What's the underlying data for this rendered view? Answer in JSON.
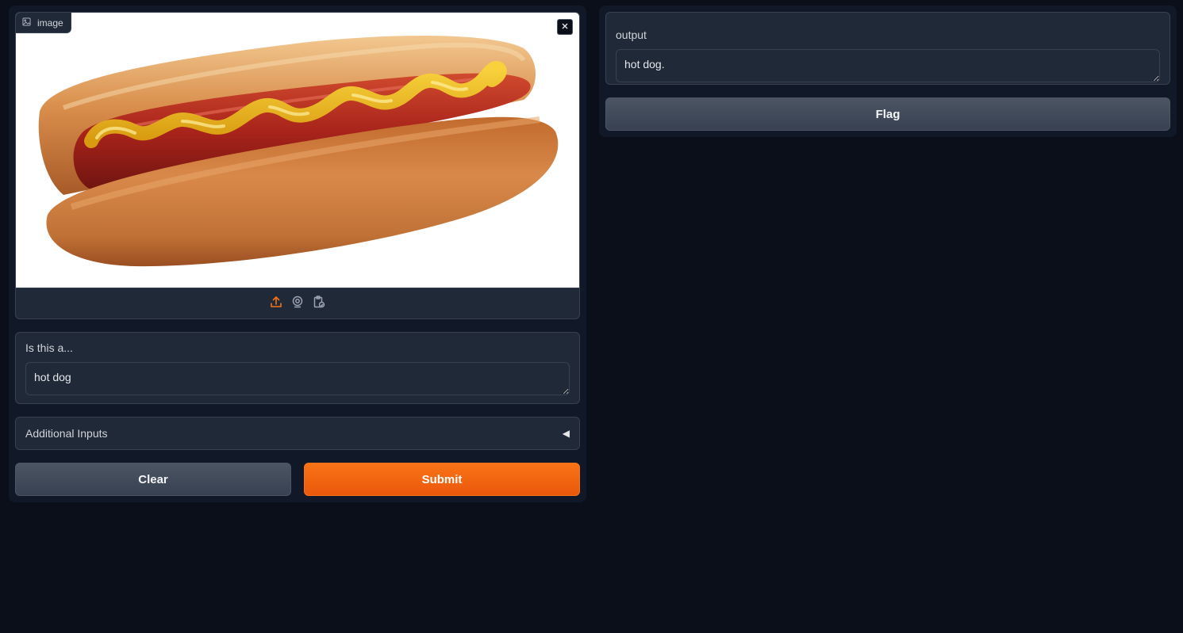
{
  "inputs": {
    "image": {
      "label": "image",
      "source_buttons": [
        {
          "name": "upload",
          "icon": "upload-icon",
          "active": true
        },
        {
          "name": "webcam",
          "icon": "webcam-icon",
          "active": false
        },
        {
          "name": "clipboard",
          "icon": "clipboard-icon",
          "active": false
        }
      ]
    },
    "question": {
      "label": "Is this a...",
      "value": "hot dog"
    },
    "accordion": {
      "label": "Additional Inputs",
      "arrow": "◀"
    }
  },
  "buttons": {
    "clear": "Clear",
    "submit": "Submit",
    "flag": "Flag"
  },
  "outputs": {
    "label": "output",
    "value": "hot dog."
  },
  "colors": {
    "accent": "#f97316",
    "background": "#0b0f19",
    "panel": "#111827",
    "block": "#1f2937"
  }
}
